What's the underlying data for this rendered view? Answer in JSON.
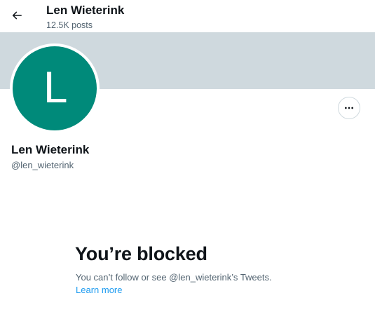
{
  "header": {
    "name": "Len Wieterink",
    "posts_count": "12.5K posts",
    "back_icon": "arrow-left-icon"
  },
  "profile": {
    "avatar_letter": "L",
    "avatar_color": "#008a7a",
    "banner_color": "#cfd9de",
    "name": "Len Wieterink",
    "handle": "@len_wieterink",
    "more_icon": "more-horizontal-icon"
  },
  "blocked": {
    "title": "You’re blocked",
    "description": "You can’t follow or see @len_wieterink’s Tweets.",
    "learn_more": "Learn more",
    "link_color": "#1d9bf0"
  }
}
